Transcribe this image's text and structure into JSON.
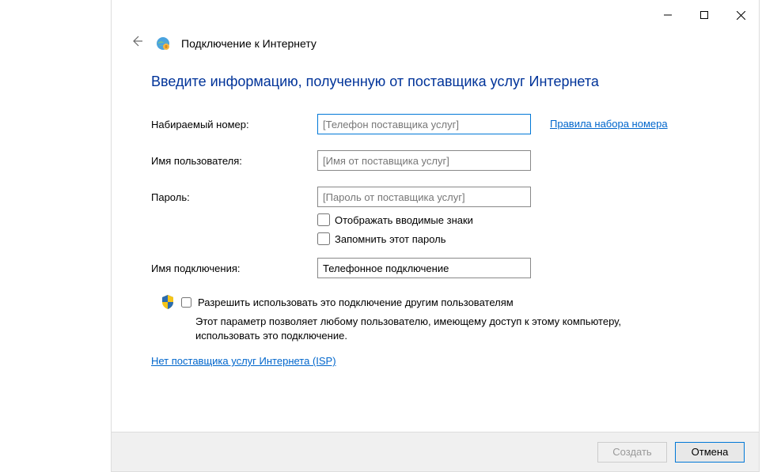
{
  "wizard": {
    "title": "Подключение к Интернету"
  },
  "heading": "Введите информацию, полученную от поставщика услуг Интернета",
  "form": {
    "phone": {
      "label": "Набираемый номер:",
      "placeholder": "[Телефон поставщика услуг]",
      "value": ""
    },
    "username": {
      "label": "Имя пользователя:",
      "placeholder": "[Имя от поставщика услуг]",
      "value": ""
    },
    "password": {
      "label": "Пароль:",
      "placeholder": "[Пароль от поставщика услуг]",
      "value": ""
    },
    "show_chars": {
      "label": "Отображать вводимые знаки",
      "checked": false
    },
    "remember": {
      "label": "Запомнить этот пароль",
      "checked": false
    },
    "connection_name": {
      "label": "Имя подключения:",
      "value": "Телефонное подключение"
    },
    "share": {
      "label": "Разрешить использовать это подключение другим пользователям",
      "description": "Этот параметр позволяет любому пользователю, имеющему доступ к этому компьютеру, использовать это подключение.",
      "checked": false
    }
  },
  "links": {
    "dialing_rules": "Правила набора номера",
    "no_isp": "Нет поставщика услуг Интернета (ISP)"
  },
  "buttons": {
    "create": "Создать",
    "cancel": "Отмена"
  }
}
